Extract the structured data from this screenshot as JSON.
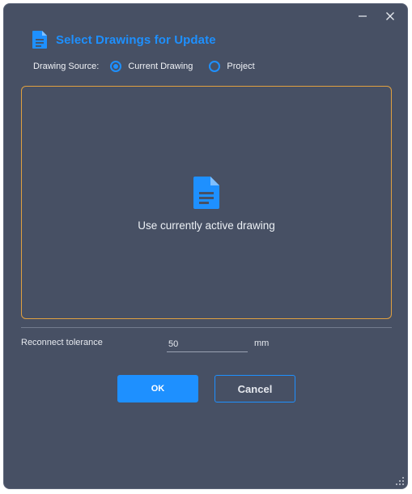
{
  "window": {
    "minimize_icon": "minimize-icon",
    "close_icon": "close-icon"
  },
  "header": {
    "title": "Select Drawings for Update",
    "icon": "document-icon",
    "accent_color": "#1e90ff"
  },
  "drawing_source": {
    "label": "Drawing Source:",
    "options": [
      {
        "label": "Current Drawing",
        "selected": true
      },
      {
        "label": "Project",
        "selected": false
      }
    ]
  },
  "preview": {
    "icon": "document-icon",
    "message": "Use currently active drawing",
    "border_color": "#e0a040"
  },
  "tolerance": {
    "label": "Reconnect tolerance",
    "value": "50",
    "unit": "mm"
  },
  "buttons": {
    "ok_label": "OK",
    "cancel_label": "Cancel"
  },
  "colors": {
    "background": "#475064",
    "accent": "#1e90ff",
    "panel_border": "#e0a040"
  }
}
